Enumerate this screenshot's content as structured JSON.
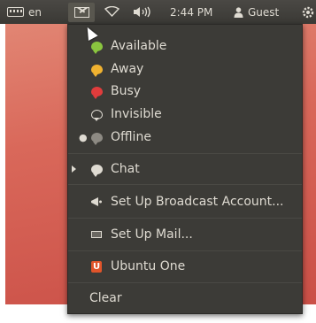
{
  "panel": {
    "keyboard_label": "en",
    "time": "2:44 PM",
    "user": "Guest",
    "icons": [
      "keyboard-icon",
      "envelope-icon",
      "wifi-icon",
      "volume-icon",
      "user-icon",
      "power-icon"
    ]
  },
  "menu": {
    "status_items": [
      {
        "label": "Available",
        "icon": "available-status-icon",
        "color": "#8ac53f"
      },
      {
        "label": "Away",
        "icon": "away-status-icon",
        "color": "#f0b230"
      },
      {
        "label": "Busy",
        "icon": "busy-status-icon",
        "color": "#e03c3c"
      },
      {
        "label": "Invisible",
        "icon": "invisible-status-icon",
        "color": "#dfdbd2"
      },
      {
        "label": "Offline",
        "icon": "offline-status-icon",
        "color": "#8d8a83",
        "selected": true
      }
    ],
    "chat_label": "Chat",
    "broadcast_label": "Set Up Broadcast Account...",
    "mail_label": "Set Up Mail...",
    "ubuntu_one_label": "Ubuntu One",
    "clear_label": "Clear"
  },
  "colors": {
    "panel_bg": "#3c3b37",
    "menu_bg": "#3c3b37",
    "text": "#dfdbd2",
    "desktop": "#d9685a",
    "ubuntu_one_orange": "#e0542a"
  }
}
